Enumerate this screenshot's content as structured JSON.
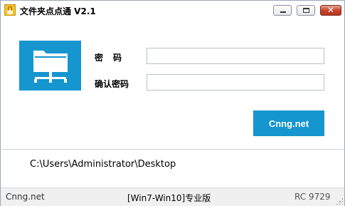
{
  "window": {
    "title": "文件夹点点通 V2.1",
    "min_glyph": "",
    "close_glyph": "✕"
  },
  "form": {
    "password_label": "密码",
    "confirm_label": "确认密码",
    "password_value": "",
    "confirm_value": "",
    "action_label": "Cnng.net"
  },
  "path": {
    "value": "C:\\Users\\Administrator\\Desktop"
  },
  "statusbar": {
    "left": "Cnng.net",
    "middle": "[Win7-Win10]专业版",
    "right": "RC 9729"
  },
  "colors": {
    "accent": "#1596cf",
    "icon": "shared-folder-icon"
  }
}
